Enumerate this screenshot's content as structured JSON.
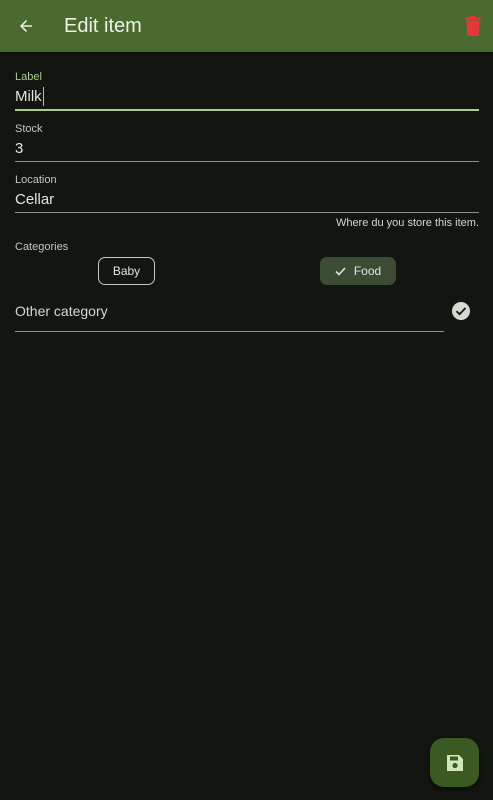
{
  "appbar": {
    "title": "Edit item",
    "back_icon": "arrow-back-icon",
    "delete_icon": "trash-icon",
    "delete_color": "#e53935",
    "bar_color": "#4b6a2f"
  },
  "form": {
    "label": {
      "caption": "Label",
      "value": "Milk"
    },
    "stock": {
      "caption": "Stock",
      "value": "3"
    },
    "location": {
      "caption": "Location",
      "value": "Cellar",
      "helper": "Where du you store this item."
    }
  },
  "categories": {
    "caption": "Categories",
    "chips": [
      {
        "label": "Baby",
        "selected": false
      },
      {
        "label": "Food",
        "selected": true
      }
    ],
    "other_placeholder": "Other category"
  },
  "fab": {
    "icon": "save-icon"
  },
  "colors": {
    "accent": "#a9cf8e",
    "background": "#121510"
  }
}
